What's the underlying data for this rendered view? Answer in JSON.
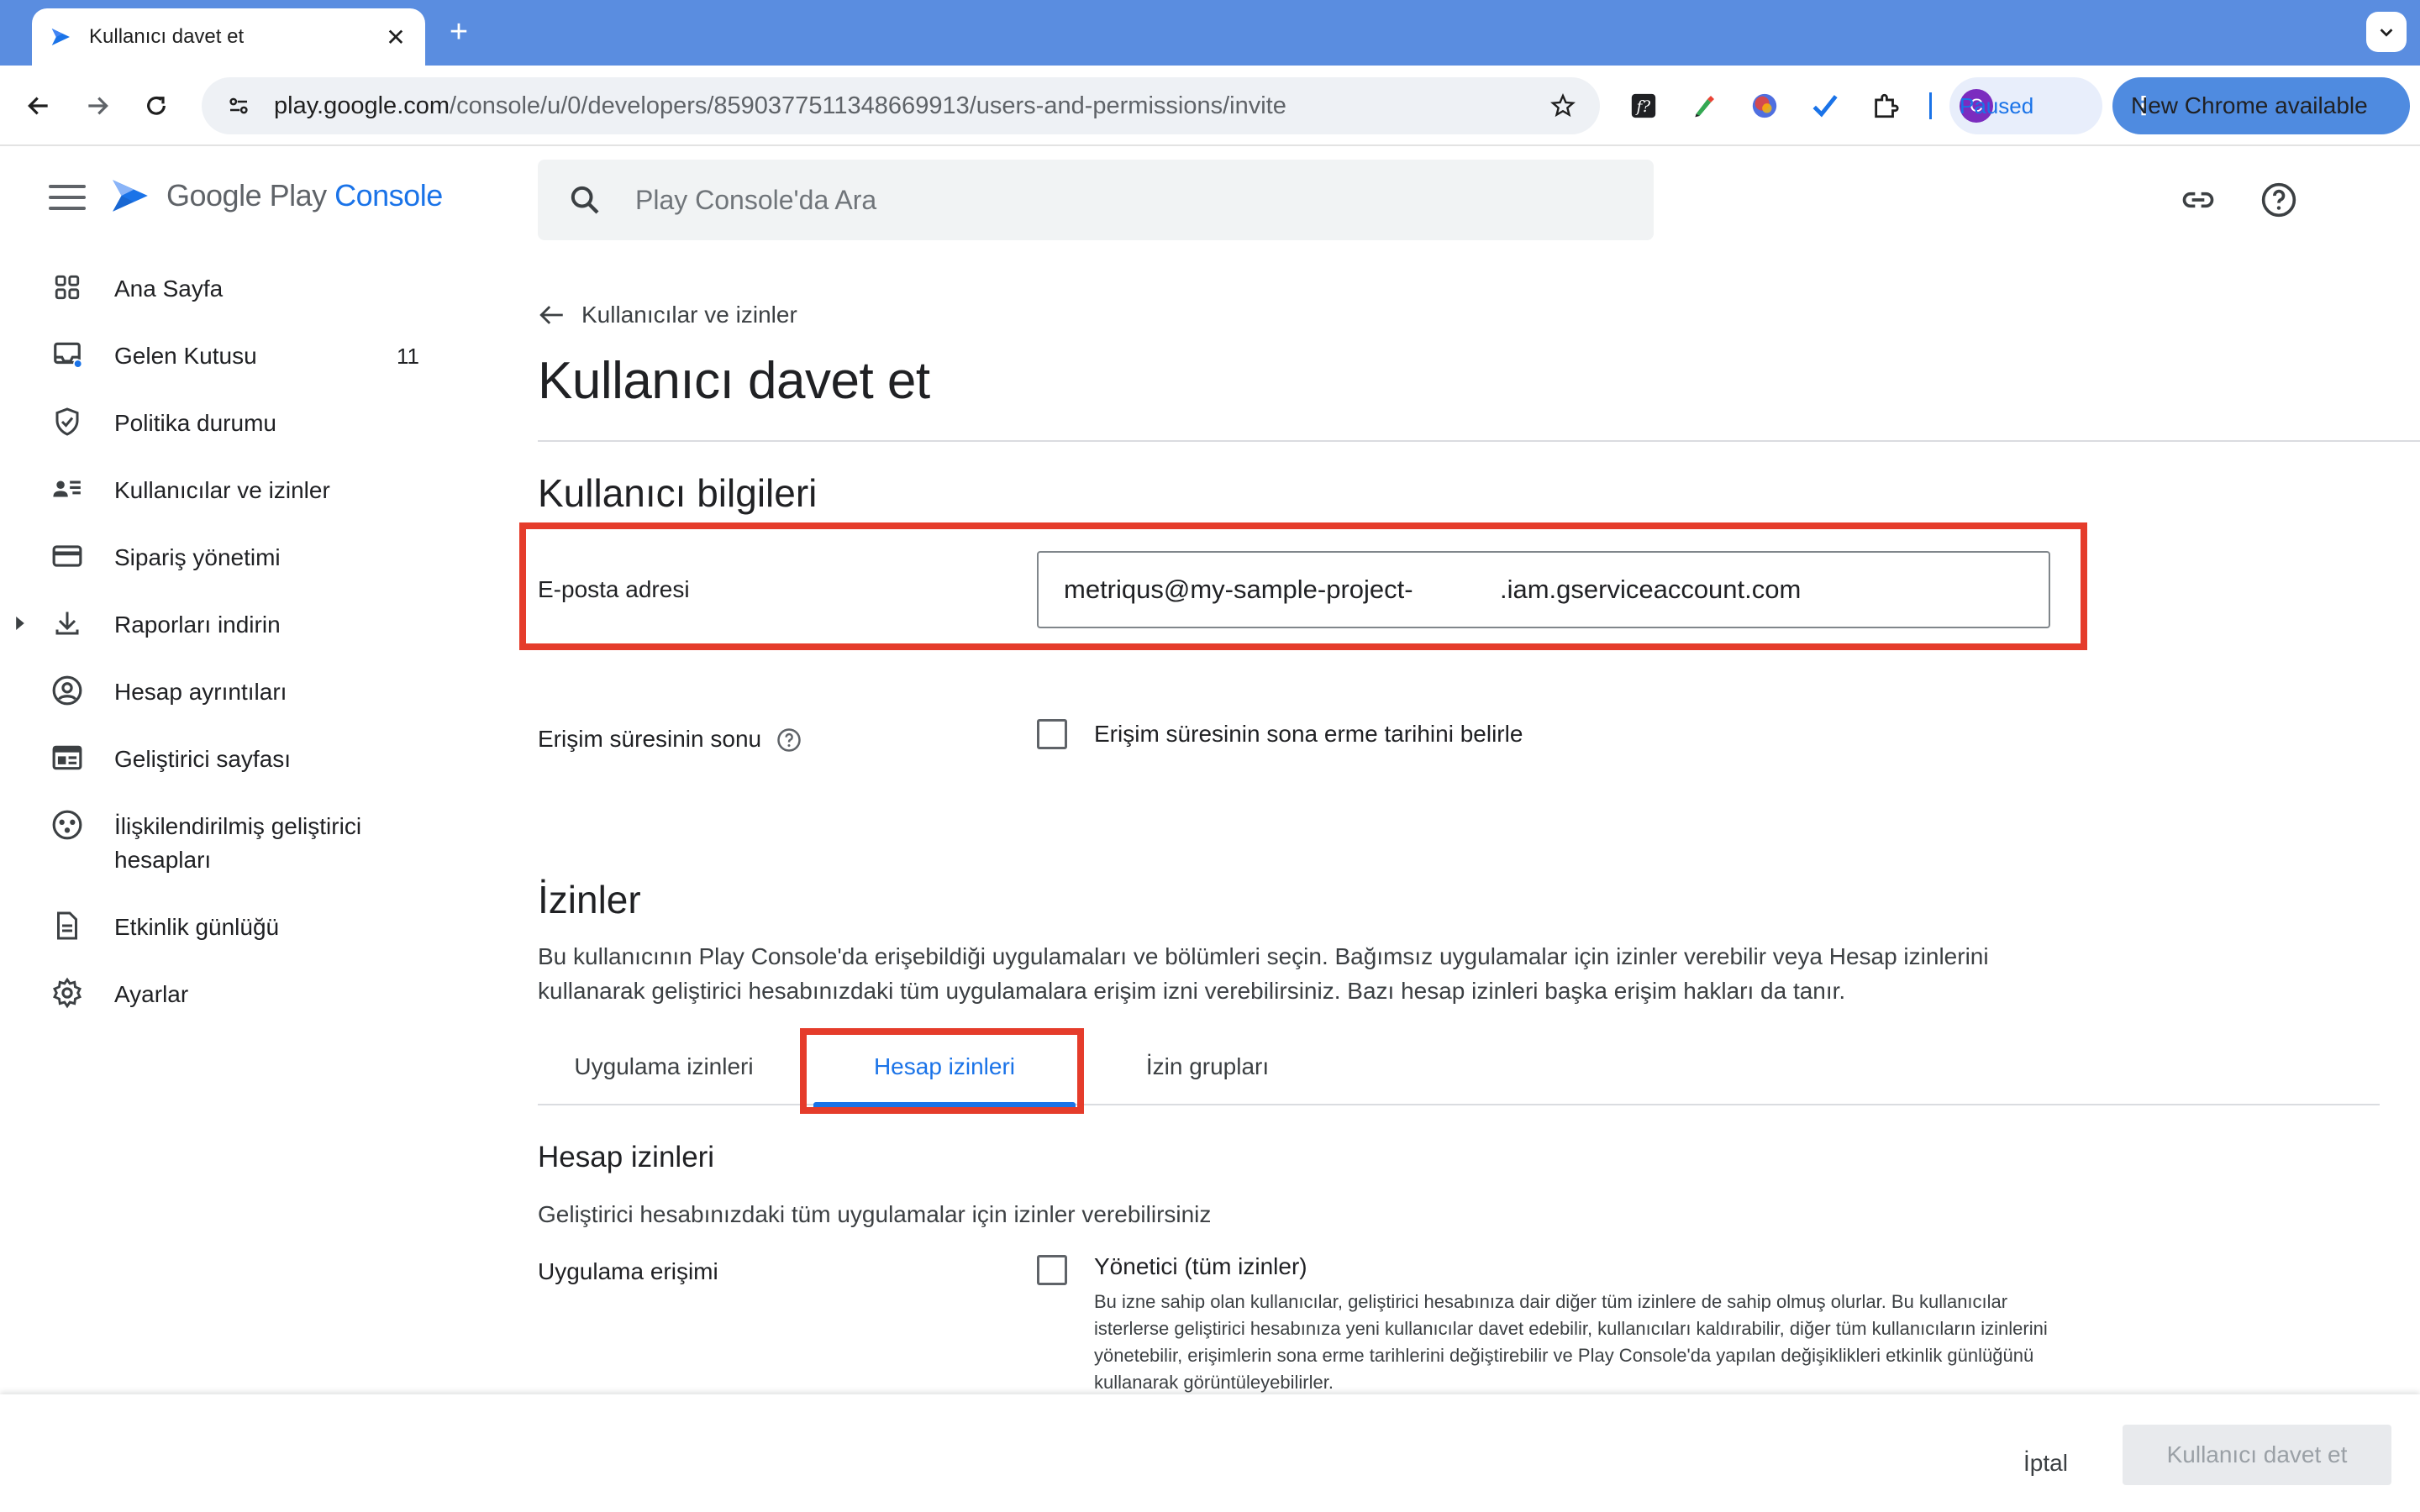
{
  "browser": {
    "tab_title": "Kullanıcı davet et",
    "url_host": "play.google.com",
    "url_path": "/console/u/0/developers/8590377511348669913/users-and-permissions/invite",
    "profile_initial": "C",
    "profile_status": "Paused",
    "update_label": "New Chrome available",
    "extension_icons": [
      "formula-extension-icon",
      "pen-extension-icon",
      "color-orb-extension-icon",
      "checkmark-extension-icon",
      "puzzle-extensions-icon"
    ]
  },
  "app": {
    "logo_prefix": "Google Play",
    "logo_accent": "Console",
    "search_placeholder": "Play Console'da Ara"
  },
  "sidebar": {
    "items": [
      {
        "label": "Ana Sayfa",
        "icon": "dashboard-grid-icon"
      },
      {
        "label": "Gelen Kutusu",
        "icon": "inbox-icon",
        "badge": "11"
      },
      {
        "label": "Politika durumu",
        "icon": "shield-check-icon"
      },
      {
        "label": "Kullanıcılar ve izinler",
        "icon": "manage-accounts-icon"
      },
      {
        "label": "Sipariş yönetimi",
        "icon": "credit-card-icon"
      },
      {
        "label": "Raporları indirin",
        "icon": "download-icon",
        "expandable": true
      },
      {
        "label": "Hesap ayrıntıları",
        "icon": "account-circle-icon"
      },
      {
        "label": "Geliştirici sayfası",
        "icon": "web-page-icon"
      },
      {
        "label": "İlişkilendirilmiş geliştirici hesapları",
        "icon": "linked-accounts-icon"
      },
      {
        "label": "Etkinlik günlüğü",
        "icon": "document-log-icon"
      },
      {
        "label": "Ayarlar",
        "icon": "settings-gear-icon"
      }
    ]
  },
  "main": {
    "breadcrumb": "Kullanıcılar ve izinler",
    "title": "Kullanıcı davet et",
    "user_info": {
      "heading": "Kullanıcı bilgileri",
      "email_label": "E-posta adresi",
      "email_value": "metriqus@my-sample-project-            .iam.gserviceaccount.com",
      "expiry_label": "Erişim süresinin sonu",
      "expiry_checkbox_label": "Erişim süresinin sona erme tarihini belirle",
      "expiry_checked": false
    },
    "permissions": {
      "heading": "İzinler",
      "description": "Bu kullanıcının Play Console'da erişebildiği uygulamaları ve bölümleri seçin. Bağımsız uygulamalar için izinler verebilir veya Hesap izinlerini kullanarak geliştirici hesabınızdaki tüm uygulamalara erişim izni verebilirsiniz. Bazı hesap izinleri başka erişim hakları da tanır.",
      "tabs": [
        {
          "label": "Uygulama izinleri",
          "active": false
        },
        {
          "label": "Hesap izinleri",
          "active": true
        },
        {
          "label": "İzin grupları",
          "active": false
        }
      ],
      "account_heading": "Hesap izinleri",
      "account_description": "Geliştirici hesabınızdaki tüm uygulamalar için izinler verebilirsiniz",
      "app_access_label": "Uygulama erişimi",
      "admin_label": "Yönetici (tüm izinler)",
      "admin_checked": false,
      "admin_description": "Bu izne sahip olan kullanıcılar, geliştirici hesabınıza dair diğer tüm izinlere de sahip olmuş olurlar. Bu kullanıcılar isterlerse geliştirici hesabınıza yeni kullanıcılar davet edebilir, kullanıcıları kaldırabilir, diğer tüm kullanıcıların izinlerini yönetebilir, erişimlerin sona erme tarihlerini değiştirebilir ve Play Console'da yapılan değişiklikleri etkinlik günlüğünü kullanarak görüntüleyebilirler."
    }
  },
  "footer": {
    "cancel_label": "İptal",
    "invite_label": "Kullanıcı davet et"
  },
  "colors": {
    "chrome_tabbar": "#5a8de0",
    "accent_blue": "#1a73e8",
    "highlight_red": "#e53c2b",
    "inbox_dot": "#1a73e8"
  }
}
